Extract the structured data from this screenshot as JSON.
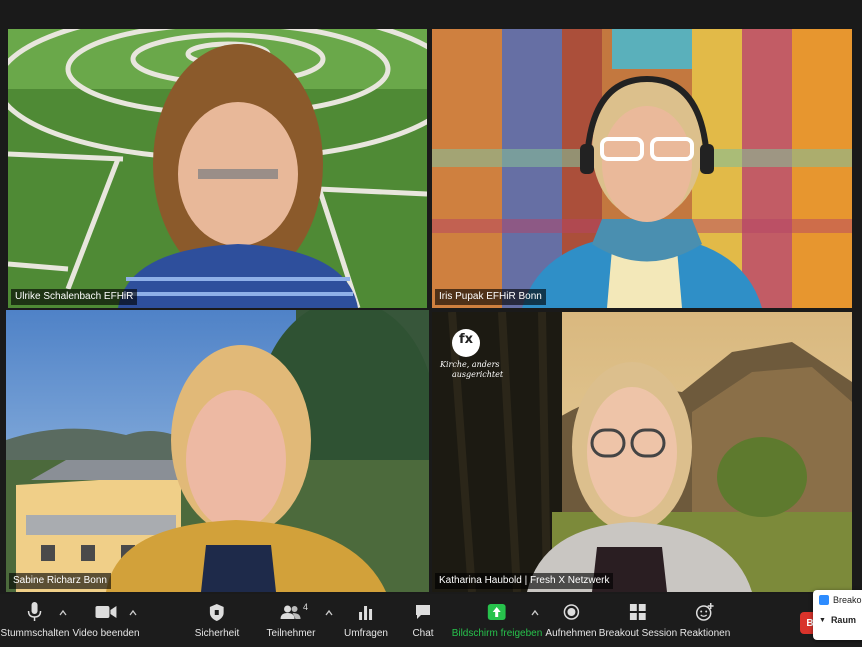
{
  "participants": [
    {
      "name": "Ulrike Schalenbach EFHiR"
    },
    {
      "name": "Iris Pupak EFHiR Bonn"
    },
    {
      "name": "Sabine Richarz Bonn"
    },
    {
      "name": "Katharina Haubold | Fresh X Netzwerk"
    }
  ],
  "logo": {
    "mark": "fx",
    "slogan_line1": "Kirche, anders",
    "slogan_line2": "ausgerichtet"
  },
  "toolbar": {
    "mute": "Stummschalten",
    "video": "Video beenden",
    "security": "Sicherheit",
    "participants": "Teilnehmer",
    "participant_count": "4",
    "polls": "Umfragen",
    "chat": "Chat",
    "share": "Bildschirm freigeben",
    "record": "Aufnehmen",
    "breakout": "Breakout Session",
    "reactions": "Reaktionen"
  },
  "popup": {
    "line1": "Breakou",
    "line2": "Raum"
  },
  "colors": {
    "active_border": "#c9d34f",
    "share_green": "#27c24c",
    "popup_icon": "#2d8cff"
  }
}
